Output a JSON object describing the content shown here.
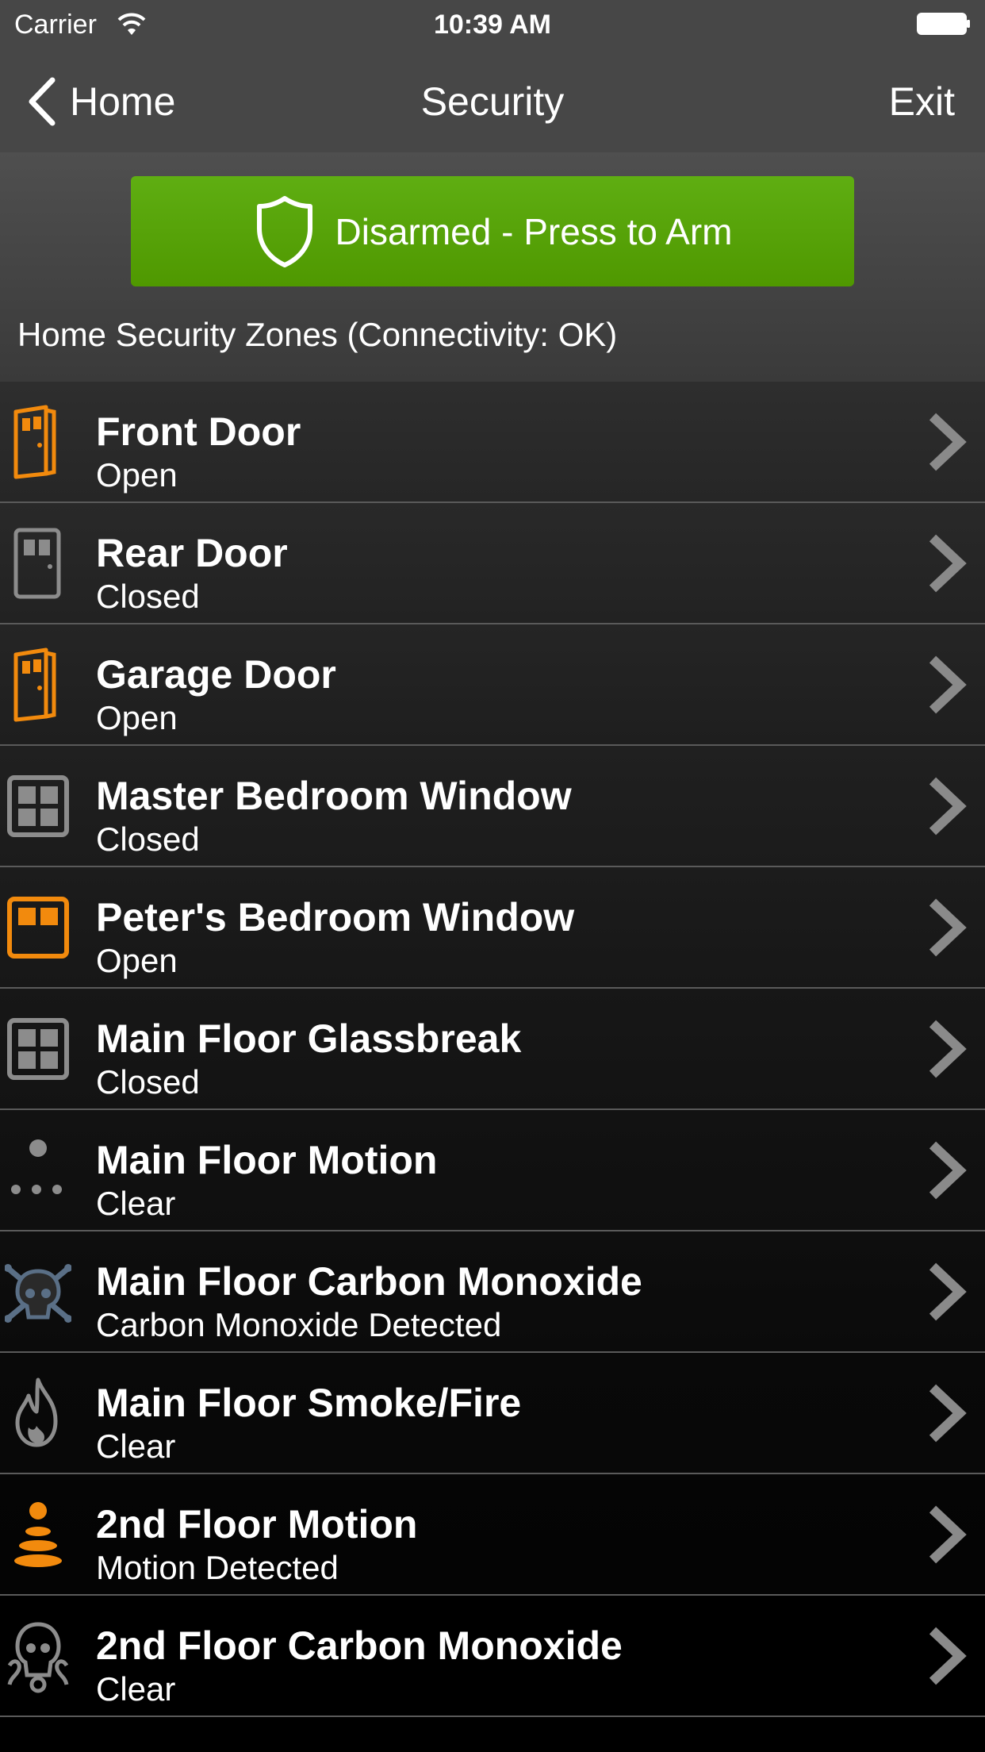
{
  "status_bar": {
    "carrier": "Carrier",
    "time": "10:39 AM"
  },
  "nav": {
    "back_label": "Home",
    "title": "Security",
    "exit_label": "Exit"
  },
  "arm_button": {
    "label": "Disarmed - Press to Arm",
    "color": "#5aa80c"
  },
  "zones_header": "Home Security Zones (Connectivity: OK)",
  "colors": {
    "alert": "#f28a0d",
    "normal": "#8c8c8c"
  },
  "zones": [
    {
      "name": "Front Door",
      "status": "Open",
      "icon": "door-open-icon",
      "alert": true
    },
    {
      "name": "Rear Door",
      "status": "Closed",
      "icon": "door-closed-icon",
      "alert": false
    },
    {
      "name": "Garage Door",
      "status": "Open",
      "icon": "door-open-icon",
      "alert": true
    },
    {
      "name": "Master Bedroom Window",
      "status": "Closed",
      "icon": "window-closed-icon",
      "alert": false
    },
    {
      "name": "Peter's Bedroom Window",
      "status": "Open",
      "icon": "window-open-icon",
      "alert": true
    },
    {
      "name": "Main Floor Glassbreak",
      "status": "Closed",
      "icon": "window-closed-icon",
      "alert": false
    },
    {
      "name": "Main Floor Motion",
      "status": "Clear",
      "icon": "motion-icon",
      "alert": false
    },
    {
      "name": "Main Floor Carbon Monoxide",
      "status": "Carbon Monoxide Detected",
      "icon": "skull-crossbones-icon",
      "alert": true
    },
    {
      "name": "Main Floor Smoke/Fire",
      "status": "Clear",
      "icon": "flame-icon",
      "alert": false
    },
    {
      "name": "2nd Floor Motion",
      "status": "Motion Detected",
      "icon": "motion-icon",
      "alert": true
    },
    {
      "name": "2nd Floor Carbon Monoxide",
      "status": "Clear",
      "icon": "skull-icon",
      "alert": false
    }
  ]
}
